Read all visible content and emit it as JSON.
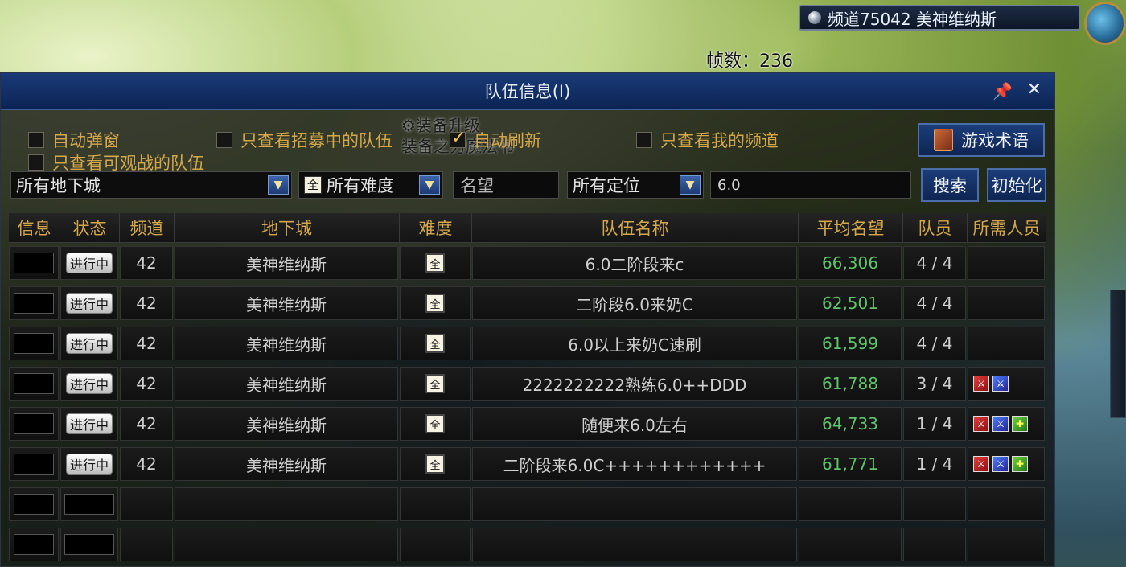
{
  "hud": {
    "channel_label": "频道75042 美神维纳斯",
    "fps_label": "帧数：236"
  },
  "window": {
    "title": "队伍信息(I)"
  },
  "filters": {
    "auto_popup": "自动弹窗",
    "recruiting_only": "只查看招募中的队伍",
    "auto_refresh": "自动刷新",
    "my_channel_only": "只查看我的频道",
    "spectatable_only": "只查看可观战的队伍",
    "term_button": "游戏术语",
    "dungeon_select": "所有地下城",
    "difficulty_select": "所有难度",
    "reputation_placeholder": "名望",
    "role_select": "所有定位",
    "keyword_value": "6.0",
    "search_button": "搜索",
    "reset_button": "初始化",
    "difficulty_icon": "全",
    "auto_refresh_checked": true
  },
  "background_overlay": {
    "line1": "⚙装备升级",
    "line2": "装备之刃魔法书"
  },
  "table": {
    "headers": [
      "信息",
      "状态",
      "频道",
      "地下城",
      "难度",
      "队伍名称",
      "平均名望",
      "队员",
      "所需人员"
    ],
    "rows": [
      {
        "status": "进行中",
        "channel": "42",
        "dungeon": "美神维纳斯",
        "difficulty": "全",
        "name": "6.0二阶段来c",
        "rating": "66,306",
        "members": "4 / 4",
        "roles": []
      },
      {
        "status": "进行中",
        "channel": "42",
        "dungeon": "美神维纳斯",
        "difficulty": "全",
        "name": "二阶段6.0来奶C",
        "rating": "62,501",
        "members": "4 / 4",
        "roles": []
      },
      {
        "status": "进行中",
        "channel": "42",
        "dungeon": "美神维纳斯",
        "difficulty": "全",
        "name": "6.0以上来奶C速刷",
        "rating": "61,599",
        "members": "4 / 4",
        "roles": []
      },
      {
        "status": "进行中",
        "channel": "42",
        "dungeon": "美神维纳斯",
        "difficulty": "全",
        "name": "2222222222熟练6.0++DDD",
        "rating": "61,788",
        "members": "3 / 4",
        "roles": [
          "sword-red",
          "sword-blue"
        ]
      },
      {
        "status": "进行中",
        "channel": "42",
        "dungeon": "美神维纳斯",
        "difficulty": "全",
        "name": "随便来6.0左右",
        "rating": "64,733",
        "members": "1 / 4",
        "roles": [
          "sword-red",
          "sword-blue",
          "heal-green"
        ]
      },
      {
        "status": "进行中",
        "channel": "42",
        "dungeon": "美神维纳斯",
        "difficulty": "全",
        "name": "二阶段来6.0C++++++++++++",
        "rating": "61,771",
        "members": "1 / 4",
        "roles": [
          "sword-red",
          "sword-blue",
          "heal-green"
        ]
      }
    ],
    "empty_rows": 2
  },
  "colors": {
    "header_text": "#d4a84a",
    "rating_text": "#5fc56a",
    "title_bar": "#1a3b78"
  }
}
